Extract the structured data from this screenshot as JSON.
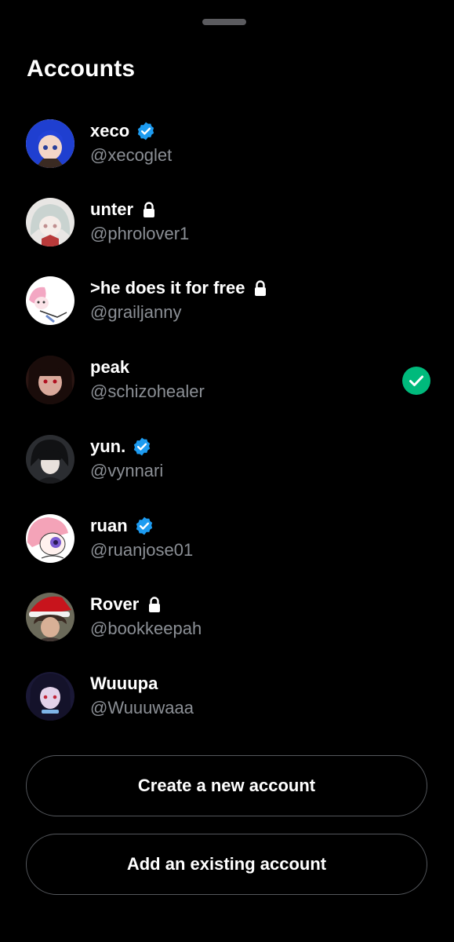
{
  "title": "Accounts",
  "accounts": [
    {
      "name": "xeco",
      "handle": "@xecoglet",
      "verified": true,
      "protected": false,
      "active": false
    },
    {
      "name": "unter",
      "handle": "@phrolover1",
      "verified": false,
      "protected": true,
      "active": false
    },
    {
      "name": ">he does it for free",
      "handle": "@grailjanny",
      "verified": false,
      "protected": true,
      "active": false
    },
    {
      "name": "peak",
      "handle": "@schizohealer",
      "verified": false,
      "protected": false,
      "active": true
    },
    {
      "name": "yun.",
      "handle": "@vynnari",
      "verified": true,
      "protected": false,
      "active": false
    },
    {
      "name": "ruan",
      "handle": "@ruanjose01",
      "verified": true,
      "protected": false,
      "active": false
    },
    {
      "name": "Rover",
      "handle": "@bookkeepah",
      "verified": false,
      "protected": true,
      "active": false
    },
    {
      "name": "Wuuupa",
      "handle": "@Wuuuwaaa",
      "verified": false,
      "protected": false,
      "active": false
    }
  ],
  "buttons": {
    "create": "Create a new account",
    "add_existing": "Add an existing account"
  },
  "colors": {
    "background": "#000000",
    "verified_badge": "#1d9bf0",
    "active_check": "#00ba7c",
    "handle_text": "#8b8f95",
    "button_border": "#54575c"
  },
  "icons": {
    "verified": "verified-badge-icon",
    "protected": "lock-icon",
    "active": "check-circle-icon"
  }
}
